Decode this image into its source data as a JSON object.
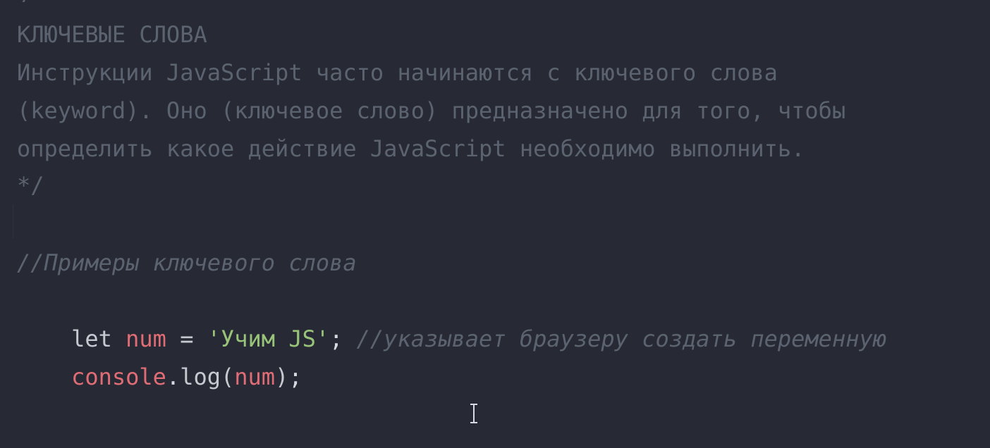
{
  "editor": {
    "top_fragment": "/",
    "comment_lines": [
      "КЛЮЧЕВЫЕ СЛОВА",
      "Инструкции JavaScript часто начинаются с ключевого слова",
      "(keyword). Оно (ключевое слово) предназначено для того, чтобы",
      "определить какое действие JavaScript необходимо выполнить.",
      "*/"
    ],
    "example_comment": "//Примеры ключевого слова",
    "code_line_1": {
      "keyword": "let",
      "variable": "num",
      "operator": "=",
      "string": "'Учим JS'",
      "semicolon": ";",
      "comment": "//указывает браузеру создать переменную"
    },
    "code_line_2": {
      "object": "console",
      "dot": ".",
      "method": "log",
      "open_paren": "(",
      "argument": "num",
      "close_paren": ")",
      "semicolon": ";"
    }
  }
}
